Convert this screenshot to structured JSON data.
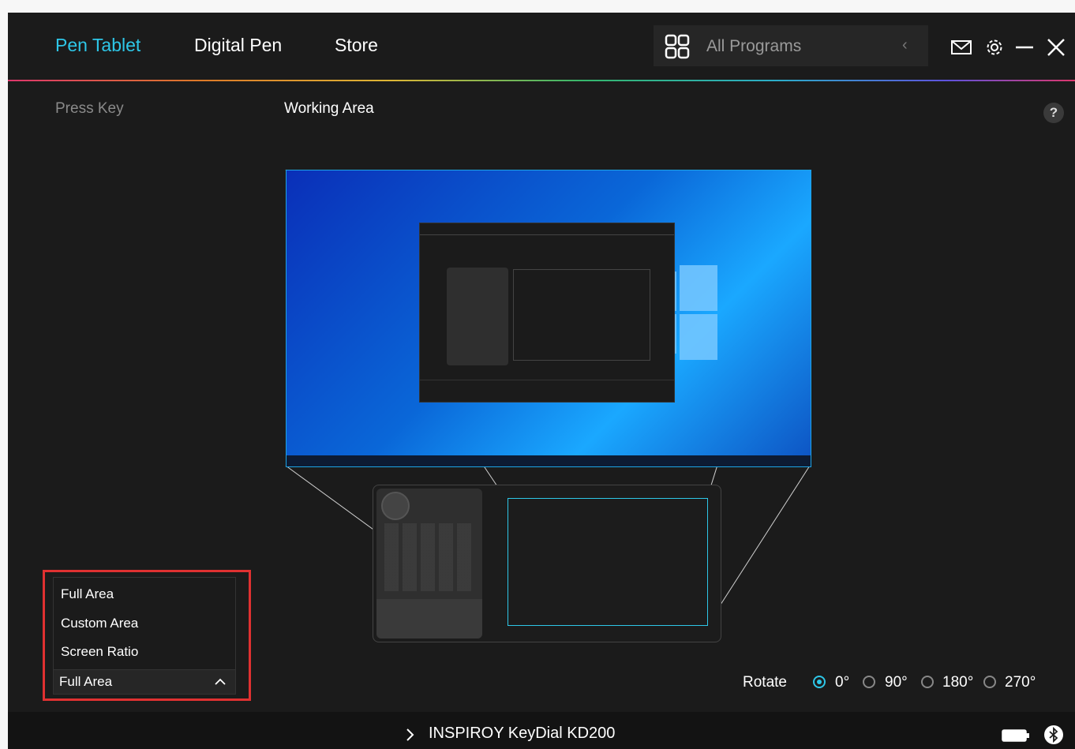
{
  "header": {
    "tabs": [
      {
        "label": "Pen Tablet",
        "active": true
      },
      {
        "label": "Digital Pen",
        "active": false
      },
      {
        "label": "Store",
        "active": false
      }
    ],
    "programs_label": "All Programs",
    "icons": [
      "apps-grid-icon",
      "chevron-left-icon",
      "mail-icon",
      "gear-icon",
      "minimize-icon",
      "close-icon"
    ]
  },
  "subnav": {
    "press_key": "Press Key",
    "working_area": "Working Area",
    "help": "?"
  },
  "dropdown": {
    "options": [
      "Full Area",
      "Custom Area",
      "Screen Ratio"
    ],
    "selected": "Full Area"
  },
  "rotate": {
    "label": "Rotate",
    "options": [
      "0°",
      "90°",
      "180°",
      "270°"
    ],
    "selected": "0°"
  },
  "footer": {
    "device_name": "INSPIROY KeyDial KD200"
  },
  "colors": {
    "accent": "#2ec7e8",
    "highlight_border": "#e03131",
    "background": "#1b1b1b"
  }
}
